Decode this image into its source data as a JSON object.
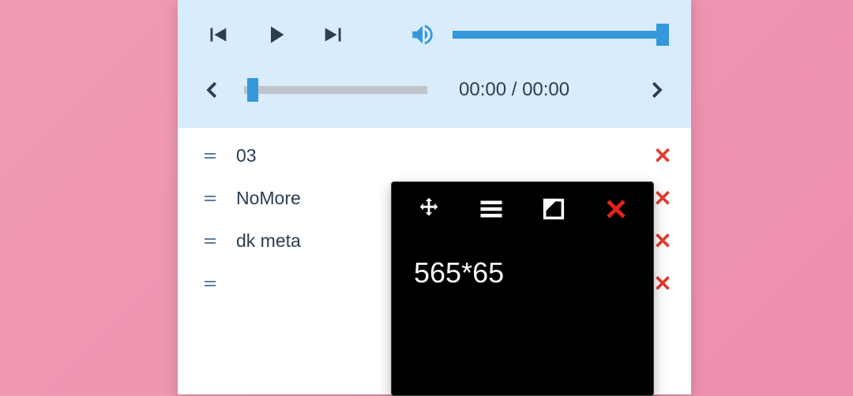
{
  "player": {
    "time_display": "00:00 / 00:00",
    "volume": 100,
    "seek_percent": 3
  },
  "tracks": [
    {
      "title": "03"
    },
    {
      "title": "NoMore"
    },
    {
      "title": "dk meta"
    },
    {
      "title": ""
    }
  ],
  "overlay": {
    "expression": "565*65"
  },
  "icons": {
    "prev": "skip-previous",
    "play": "play",
    "next": "skip-next",
    "volume": "volume-high",
    "chev_left": "chevron-left",
    "chev_right": "chevron-right",
    "delete": "✕",
    "move": "move-arrows",
    "menu": "menu",
    "resize": "resize-corner",
    "close": "✕"
  }
}
